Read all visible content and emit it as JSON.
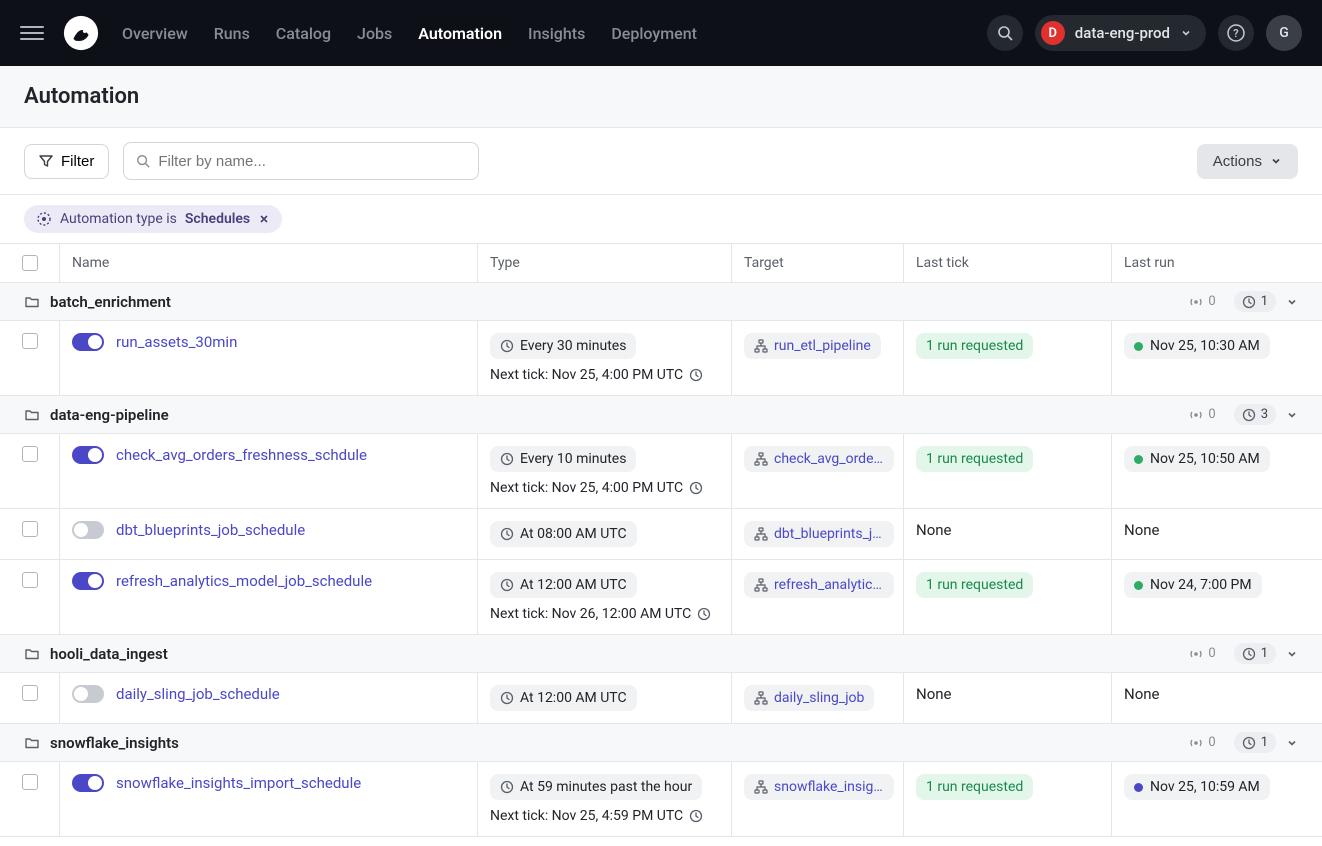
{
  "nav": {
    "links": [
      "Overview",
      "Runs",
      "Catalog",
      "Jobs",
      "Automation",
      "Insights",
      "Deployment"
    ],
    "active": "Automation",
    "deployment_badge": "D",
    "deployment_name": "data-eng-prod",
    "avatar": "G"
  },
  "page": {
    "title": "Automation"
  },
  "toolbar": {
    "filter_label": "Filter",
    "search_placeholder": "Filter by name...",
    "actions_label": "Actions"
  },
  "chip": {
    "prefix": "Automation type is",
    "value": "Schedules"
  },
  "columns": [
    "Name",
    "Type",
    "Target",
    "Last tick",
    "Last run"
  ],
  "groups": [
    {
      "name": "batch_enrichment",
      "sensor_count": "0",
      "schedule_count": "1",
      "rows": [
        {
          "enabled": true,
          "name": "run_assets_30min",
          "schedule": "Every 30 minutes",
          "next_tick": "Next tick: Nov 25, 4:00 PM UTC",
          "target": "run_etl_pipeline",
          "last_tick": "1 run requested",
          "last_run": "Nov 25, 10:30 AM",
          "run_dot": "green"
        }
      ]
    },
    {
      "name": "data-eng-pipeline",
      "sensor_count": "0",
      "schedule_count": "3",
      "rows": [
        {
          "enabled": true,
          "name": "check_avg_orders_freshness_schdule",
          "schedule": "Every 10 minutes",
          "next_tick": "Next tick: Nov 25, 4:00 PM UTC",
          "target": "check_avg_orders_",
          "last_tick": "1 run requested",
          "last_run": "Nov 25, 10:50 AM",
          "run_dot": "green"
        },
        {
          "enabled": false,
          "name": "dbt_blueprints_job_schedule",
          "schedule": "At 08:00 AM UTC",
          "next_tick": "",
          "target": "dbt_blueprints_job",
          "last_tick": "None",
          "last_run": "None",
          "run_dot": ""
        },
        {
          "enabled": true,
          "name": "refresh_analytics_model_job_schedule",
          "schedule": "At 12:00 AM UTC",
          "next_tick": "Next tick: Nov 26, 12:00 AM UTC",
          "target": "refresh_analytics_r",
          "last_tick": "1 run requested",
          "last_run": "Nov 24, 7:00 PM",
          "run_dot": "green"
        }
      ]
    },
    {
      "name": "hooli_data_ingest",
      "sensor_count": "0",
      "schedule_count": "1",
      "rows": [
        {
          "enabled": false,
          "name": "daily_sling_job_schedule",
          "schedule": "At 12:00 AM UTC",
          "next_tick": "",
          "target": "daily_sling_job",
          "last_tick": "None",
          "last_run": "None",
          "run_dot": ""
        }
      ]
    },
    {
      "name": "snowflake_insights",
      "sensor_count": "0",
      "schedule_count": "1",
      "rows": [
        {
          "enabled": true,
          "name": "snowflake_insights_import_schedule",
          "schedule": "At 59 minutes past the hour",
          "next_tick": "Next tick: Nov 25, 4:59 PM UTC",
          "target": "snowflake_insights",
          "last_tick": "1 run requested",
          "last_run": "Nov 25, 10:59 AM",
          "run_dot": "blue"
        }
      ]
    }
  ]
}
